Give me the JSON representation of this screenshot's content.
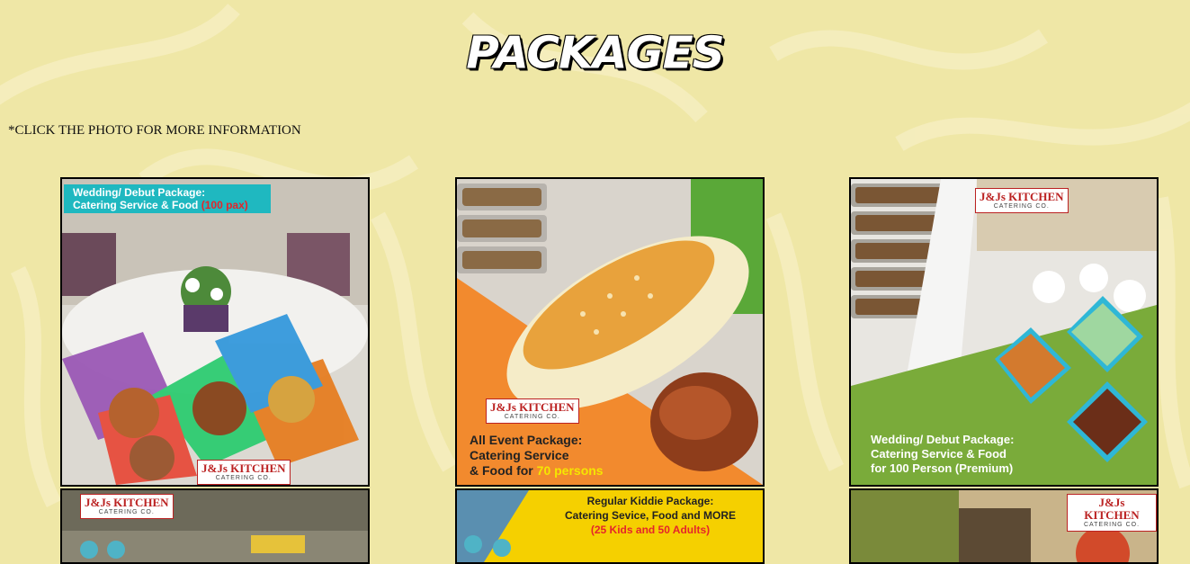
{
  "page": {
    "title": "PACKAGES",
    "note": "*CLICK THE PHOTO FOR MORE INFORMATION"
  },
  "brand": {
    "name": "J&Js KITCHEN",
    "sub": "CATERING CO."
  },
  "packages": [
    {
      "line1": "Wedding/ Debut Package:",
      "line2": "Catering Service & Food",
      "highlight": "(100 pax)"
    },
    {
      "line1": "All Event Package:",
      "line2": "Catering Service",
      "line3": "& Food for",
      "highlight": "70 persons"
    },
    {
      "line1": "Wedding/ Debut Package:",
      "line2": "Catering Service & Food",
      "line3": "for 100 Person (Premium)"
    },
    {
      "line1": ""
    },
    {
      "line1": "Regular Kiddie Package:",
      "line2": "Catering Sevice, Food and MORE",
      "highlight": "(25 Kids and 50 Adults)"
    },
    {
      "line1": ""
    }
  ],
  "colors": {
    "background": "#efe7a6",
    "accent_orange": "#f28a2e",
    "accent_green": "#7aab3a",
    "accent_teal": "#1fb8c0",
    "accent_yellow": "#f5d000"
  }
}
